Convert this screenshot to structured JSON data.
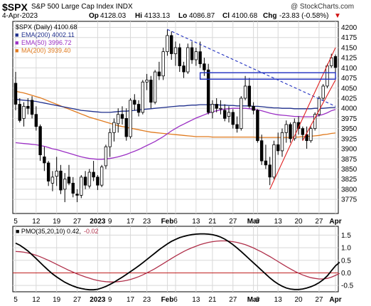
{
  "header": {
    "symbol": "$SPX",
    "name": "S&P 500 Large Cap Index  INDX",
    "watermark": "@ StockCharts.com",
    "date": "4-Apr-2023",
    "open_label": "Op",
    "open": "4128.03",
    "high_label": "Hi",
    "high": "4133.13",
    "low_label": "Lo",
    "low": "4086.87",
    "close_label": "Cl",
    "close": "4100.68",
    "change_label": "Chg",
    "change": "-23.83 (-0.58%)",
    "change_arrow": "▼"
  },
  "colors": {
    "up_candle": "#ffffff",
    "down_candle": "#000000",
    "ema200": "#1f2f8c",
    "ema50": "#9b2fc4",
    "ma200": "#e07a1e",
    "trendline_red": "#e02020",
    "trendline_blue": "#2030c0",
    "box": "#2030c0",
    "pmo_line": "#000000",
    "pmo_signal": "#b0304a",
    "pmo_zero": "#c02020",
    "change_red": "#d01010"
  },
  "chart_data": [
    {
      "type": "candlestick",
      "title": "$SPX (Daily) 4100.68",
      "legend": [
        {
          "name": "EMA(200) 4002.11",
          "color": "#1f2f8c"
        },
        {
          "name": "EMA(50) 3996.72",
          "color": "#9b2fc4"
        },
        {
          "name": "MA(200) 3939.40",
          "color": "#e07a1e"
        }
      ],
      "legend_marker": "■",
      "ylim": [
        3740,
        4215
      ],
      "yticks": [
        3775,
        3800,
        3825,
        3850,
        3875,
        3900,
        3925,
        3950,
        3975,
        4000,
        4025,
        4050,
        4075,
        4100,
        4125,
        4150,
        4175,
        4200
      ],
      "x_labels": [
        {
          "i": 0,
          "label": "5"
        },
        {
          "i": 5,
          "label": "12"
        },
        {
          "i": 10,
          "label": "19"
        },
        {
          "i": 15,
          "label": "27"
        },
        {
          "i": 20,
          "label": "2023"
        },
        {
          "i": 23,
          "label": "9"
        },
        {
          "i": 28,
          "label": "17"
        },
        {
          "i": 32,
          "label": "23"
        },
        {
          "i": 37,
          "label": "Feb"
        },
        {
          "i": 39,
          "label": "6"
        },
        {
          "i": 44,
          "label": "13"
        },
        {
          "i": 48,
          "label": "21"
        },
        {
          "i": 53,
          "label": "27"
        },
        {
          "i": 58,
          "label": "Mar"
        },
        {
          "i": 59,
          "label": "6"
        },
        {
          "i": 64,
          "label": "13"
        },
        {
          "i": 69,
          "label": "20"
        },
        {
          "i": 74,
          "label": "27"
        },
        {
          "i": 78,
          "label": "Apr"
        }
      ],
      "candles": [
        {
          "o": 4062,
          "h": 4090,
          "l": 3995,
          "c": 4010
        },
        {
          "o": 4010,
          "h": 4025,
          "l": 3965,
          "c": 3970
        },
        {
          "o": 3975,
          "h": 4015,
          "l": 3955,
          "c": 4005
        },
        {
          "o": 4005,
          "h": 4025,
          "l": 3985,
          "c": 4000
        },
        {
          "o": 4020,
          "h": 4030,
          "l": 3975,
          "c": 3985
        },
        {
          "o": 3985,
          "h": 4005,
          "l": 3945,
          "c": 3955
        },
        {
          "o": 3955,
          "h": 3960,
          "l": 3870,
          "c": 3885
        },
        {
          "o": 3880,
          "h": 3905,
          "l": 3845,
          "c": 3865
        },
        {
          "o": 3865,
          "h": 3870,
          "l": 3808,
          "c": 3820
        },
        {
          "o": 3815,
          "h": 3845,
          "l": 3795,
          "c": 3830
        },
        {
          "o": 3832,
          "h": 3880,
          "l": 3808,
          "c": 3845
        },
        {
          "o": 3845,
          "h": 3860,
          "l": 3788,
          "c": 3798
        },
        {
          "o": 3800,
          "h": 3840,
          "l": 3768,
          "c": 3825
        },
        {
          "o": 3830,
          "h": 3860,
          "l": 3810,
          "c": 3815
        },
        {
          "o": 3815,
          "h": 3830,
          "l": 3780,
          "c": 3790
        },
        {
          "o": 3788,
          "h": 3800,
          "l": 3768,
          "c": 3785
        },
        {
          "o": 3785,
          "h": 3835,
          "l": 3778,
          "c": 3830
        },
        {
          "o": 3830,
          "h": 3845,
          "l": 3800,
          "c": 3810
        },
        {
          "o": 3808,
          "h": 3850,
          "l": 3802,
          "c": 3842
        },
        {
          "o": 3842,
          "h": 3870,
          "l": 3820,
          "c": 3830
        },
        {
          "o": 3830,
          "h": 3835,
          "l": 3798,
          "c": 3810
        },
        {
          "o": 3810,
          "h": 3860,
          "l": 3805,
          "c": 3855
        },
        {
          "o": 3858,
          "h": 3910,
          "l": 3850,
          "c": 3905
        },
        {
          "o": 3905,
          "h": 3950,
          "l": 3880,
          "c": 3940
        },
        {
          "o": 3940,
          "h": 3975,
          "l": 3918,
          "c": 3965
        },
        {
          "o": 3962,
          "h": 4000,
          "l": 3940,
          "c": 3985
        },
        {
          "o": 3985,
          "h": 4005,
          "l": 3960,
          "c": 3975
        },
        {
          "o": 3975,
          "h": 4000,
          "l": 3920,
          "c": 3930
        },
        {
          "o": 3930,
          "h": 4025,
          "l": 3925,
          "c": 4020
        },
        {
          "o": 4020,
          "h": 4035,
          "l": 3995,
          "c": 4010
        },
        {
          "o": 4010,
          "h": 4020,
          "l": 3980,
          "c": 3990
        },
        {
          "o": 3990,
          "h": 4070,
          "l": 3985,
          "c": 4065
        },
        {
          "o": 4065,
          "h": 4085,
          "l": 4045,
          "c": 4070
        },
        {
          "o": 4070,
          "h": 4080,
          "l": 4000,
          "c": 4015
        },
        {
          "o": 4015,
          "h": 4095,
          "l": 4010,
          "c": 4090
        },
        {
          "o": 4090,
          "h": 4115,
          "l": 4070,
          "c": 4080
        },
        {
          "o": 4080,
          "h": 4150,
          "l": 4070,
          "c": 4140
        },
        {
          "o": 4140,
          "h": 4195,
          "l": 4130,
          "c": 4180
        },
        {
          "o": 4180,
          "h": 4190,
          "l": 4120,
          "c": 4135
        },
        {
          "o": 4135,
          "h": 4165,
          "l": 4105,
          "c": 4150
        },
        {
          "o": 4150,
          "h": 4160,
          "l": 4090,
          "c": 4105
        },
        {
          "o": 4105,
          "h": 4115,
          "l": 4075,
          "c": 4090
        },
        {
          "o": 4090,
          "h": 4160,
          "l": 4085,
          "c": 4150
        },
        {
          "o": 4150,
          "h": 4165,
          "l": 4110,
          "c": 4120
        },
        {
          "o": 4120,
          "h": 4150,
          "l": 4105,
          "c": 4140
        },
        {
          "o": 4140,
          "h": 4165,
          "l": 4100,
          "c": 4110
        },
        {
          "o": 4110,
          "h": 4125,
          "l": 4080,
          "c": 4095
        },
        {
          "o": 4095,
          "h": 4110,
          "l": 3985,
          "c": 3990
        },
        {
          "o": 3990,
          "h": 4020,
          "l": 3975,
          "c": 4010
        },
        {
          "o": 4010,
          "h": 4025,
          "l": 3990,
          "c": 4000
        },
        {
          "o": 4000,
          "h": 4020,
          "l": 3985,
          "c": 4000
        },
        {
          "o": 3995,
          "h": 4010,
          "l": 3968,
          "c": 3975
        },
        {
          "o": 3980,
          "h": 4005,
          "l": 3965,
          "c": 3990
        },
        {
          "o": 3990,
          "h": 3998,
          "l": 3950,
          "c": 3960
        },
        {
          "o": 3960,
          "h": 3980,
          "l": 3940,
          "c": 3950
        },
        {
          "o": 3950,
          "h": 4030,
          "l": 3945,
          "c": 4025
        },
        {
          "o": 4025,
          "h": 4080,
          "l": 4020,
          "c": 4055
        },
        {
          "o": 4055,
          "h": 4075,
          "l": 4000,
          "c": 4005
        },
        {
          "o": 4005,
          "h": 4015,
          "l": 3985,
          "c": 3995
        },
        {
          "o": 3995,
          "h": 3998,
          "l": 3915,
          "c": 3920
        },
        {
          "o": 3920,
          "h": 3935,
          "l": 3860,
          "c": 3870
        },
        {
          "o": 3870,
          "h": 3910,
          "l": 3850,
          "c": 3860
        },
        {
          "o": 3860,
          "h": 3880,
          "l": 3810,
          "c": 3830
        },
        {
          "o": 3830,
          "h": 3920,
          "l": 3825,
          "c": 3910
        },
        {
          "o": 3910,
          "h": 3940,
          "l": 3885,
          "c": 3895
        },
        {
          "o": 3895,
          "h": 3950,
          "l": 3880,
          "c": 3940
        },
        {
          "o": 3940,
          "h": 3970,
          "l": 3915,
          "c": 3960
        },
        {
          "o": 3960,
          "h": 3965,
          "l": 3915,
          "c": 3925
        },
        {
          "o": 3925,
          "h": 3975,
          "l": 3920,
          "c": 3965
        },
        {
          "o": 3965,
          "h": 3980,
          "l": 3935,
          "c": 3950
        },
        {
          "o": 3950,
          "h": 3955,
          "l": 3920,
          "c": 3935
        },
        {
          "o": 3935,
          "h": 3955,
          "l": 3900,
          "c": 3920
        },
        {
          "o": 3920,
          "h": 3955,
          "l": 3915,
          "c": 3950
        },
        {
          "o": 3950,
          "h": 3990,
          "l": 3945,
          "c": 3985
        },
        {
          "o": 3985,
          "h": 4030,
          "l": 3980,
          "c": 4025
        },
        {
          "o": 4025,
          "h": 4060,
          "l": 4020,
          "c": 4055
        },
        {
          "o": 4055,
          "h": 4110,
          "l": 4050,
          "c": 4105
        },
        {
          "o": 4105,
          "h": 4135,
          "l": 4100,
          "c": 4125
        },
        {
          "o": 4128,
          "h": 4133,
          "l": 4087,
          "c": 4101
        }
      ],
      "ema200": [
        4022,
        4021,
        4020,
        4019,
        4018,
        4017,
        4015,
        4013,
        4011,
        4009,
        4007,
        4005,
        4003,
        4001,
        3999,
        3997,
        3995,
        3994,
        3993,
        3992,
        3991,
        3990,
        3990,
        3990,
        3991,
        3992,
        3993,
        3993,
        3994,
        3995,
        3996,
        3997,
        3998,
        3999,
        4000,
        4001,
        4002,
        4003,
        4004,
        4005,
        4006,
        4006,
        4007,
        4008,
        4008,
        4009,
        4009,
        4009,
        4009,
        4009,
        4008,
        4008,
        4007,
        4007,
        4006,
        4006,
        4006,
        4006,
        4005,
        4005,
        4004,
        4003,
        4002,
        4001,
        4001,
        4000,
        4000,
        4000,
        3999,
        3999,
        3999,
        3999,
        3999,
        4000,
        4000,
        4000,
        4001,
        4002,
        4002
      ],
      "ema50": [
        3915,
        3914,
        3913,
        3912,
        3911,
        3910,
        3908,
        3906,
        3903,
        3900,
        3898,
        3895,
        3892,
        3889,
        3886,
        3883,
        3880,
        3878,
        3876,
        3875,
        3874,
        3874,
        3875,
        3876,
        3878,
        3880,
        3883,
        3886,
        3890,
        3894,
        3898,
        3903,
        3908,
        3913,
        3918,
        3924,
        3930,
        3937,
        3944,
        3950,
        3956,
        3961,
        3966,
        3971,
        3976,
        3980,
        3984,
        3988,
        3991,
        3994,
        3996,
        3998,
        3999,
        4000,
        4000,
        4000,
        4000,
        3999,
        3998,
        3996,
        3994,
        3991,
        3988,
        3986,
        3984,
        3983,
        3982,
        3981,
        3980,
        3980,
        3979,
        3979,
        3979,
        3980,
        3982,
        3985,
        3989,
        3994,
        3997
      ],
      "ma200": [
        4042,
        4040,
        4038,
        4035,
        4032,
        4029,
        4026,
        4022,
        4018,
        4014,
        4010,
        4006,
        4002,
        3998,
        3994,
        3990,
        3986,
        3982,
        3978,
        3975,
        3972,
        3969,
        3966,
        3963,
        3960,
        3957,
        3955,
        3953,
        3951,
        3949,
        3947,
        3945,
        3943,
        3941,
        3940,
        3939,
        3938,
        3937,
        3936,
        3935,
        3934,
        3933,
        3932,
        3931,
        3930,
        3930,
        3930,
        3930,
        3929,
        3929,
        3929,
        3929,
        3929,
        3929,
        3929,
        3929,
        3929,
        3929,
        3929,
        3928,
        3928,
        3928,
        3928,
        3928,
        3928,
        3928,
        3928,
        3928,
        3929,
        3929,
        3930,
        3930,
        3931,
        3932,
        3933,
        3935,
        3936,
        3938,
        3939
      ],
      "trendlines": [
        {
          "kind": "line",
          "color": "blue",
          "dashed": true,
          "from": {
            "i": 37,
            "v": 4195
          },
          "to": {
            "i": 78,
            "v": 4005
          }
        },
        {
          "kind": "line",
          "color": "red",
          "from": {
            "i": 62,
            "v": 3800
          },
          "to": {
            "i": 78,
            "v": 4150
          }
        },
        {
          "kind": "line",
          "color": "red",
          "from": {
            "i": 70,
            "v": 3920
          },
          "to": {
            "i": 78,
            "v": 4070
          }
        },
        {
          "kind": "box",
          "color": "blue",
          "from": {
            "i": 45,
            "v": 4088
          },
          "to": {
            "i": 78,
            "v": 4072
          }
        }
      ]
    },
    {
      "type": "line",
      "title": "PMO(35,20,10) 0.42, -0.02",
      "title_main": "PMO(35,20,10) 0.42,",
      "title_signal": "-0.02",
      "ylim": [
        -0.75,
        1.85
      ],
      "yticks": [
        -0.5,
        0.0,
        0.5,
        1.0,
        1.5
      ],
      "ytick_labels": [
        "-0.5",
        "0.0",
        "0.5",
        "1.0",
        "1.5"
      ],
      "zero_line": 0.0,
      "pmo": [
        1.18,
        1.1,
        0.99,
        0.87,
        0.72,
        0.57,
        0.41,
        0.25,
        0.1,
        -0.04,
        -0.16,
        -0.27,
        -0.37,
        -0.45,
        -0.52,
        -0.58,
        -0.62,
        -0.65,
        -0.67,
        -0.67,
        -0.65,
        -0.6,
        -0.54,
        -0.46,
        -0.37,
        -0.27,
        -0.17,
        -0.06,
        0.05,
        0.16,
        0.28,
        0.4,
        0.53,
        0.66,
        0.79,
        0.92,
        1.04,
        1.15,
        1.25,
        1.33,
        1.4,
        1.45,
        1.49,
        1.52,
        1.54,
        1.55,
        1.55,
        1.54,
        1.52,
        1.48,
        1.42,
        1.34,
        1.24,
        1.12,
        0.99,
        0.85,
        0.7,
        0.55,
        0.4,
        0.25,
        0.1,
        -0.05,
        -0.2,
        -0.33,
        -0.44,
        -0.53,
        -0.6,
        -0.64,
        -0.66,
        -0.66,
        -0.64,
        -0.6,
        -0.55,
        -0.48,
        -0.39,
        -0.27,
        -0.12,
        0.08,
        0.28,
        0.42
      ],
      "signal": [
        0.85,
        0.84,
        0.82,
        0.79,
        0.75,
        0.7,
        0.64,
        0.57,
        0.5,
        0.42,
        0.34,
        0.26,
        0.18,
        0.1,
        0.03,
        -0.04,
        -0.1,
        -0.16,
        -0.21,
        -0.26,
        -0.3,
        -0.33,
        -0.35,
        -0.36,
        -0.36,
        -0.35,
        -0.33,
        -0.3,
        -0.26,
        -0.21,
        -0.15,
        -0.08,
        0.0,
        0.08,
        0.17,
        0.27,
        0.37,
        0.47,
        0.57,
        0.67,
        0.76,
        0.85,
        0.93,
        1.0,
        1.06,
        1.12,
        1.17,
        1.21,
        1.24,
        1.26,
        1.27,
        1.27,
        1.26,
        1.24,
        1.21,
        1.17,
        1.12,
        1.06,
        0.99,
        0.91,
        0.83,
        0.74,
        0.65,
        0.55,
        0.45,
        0.35,
        0.25,
        0.16,
        0.07,
        -0.01,
        -0.08,
        -0.14,
        -0.19,
        -0.22,
        -0.24,
        -0.24,
        -0.22,
        -0.17,
        -0.1,
        -0.02
      ]
    }
  ]
}
